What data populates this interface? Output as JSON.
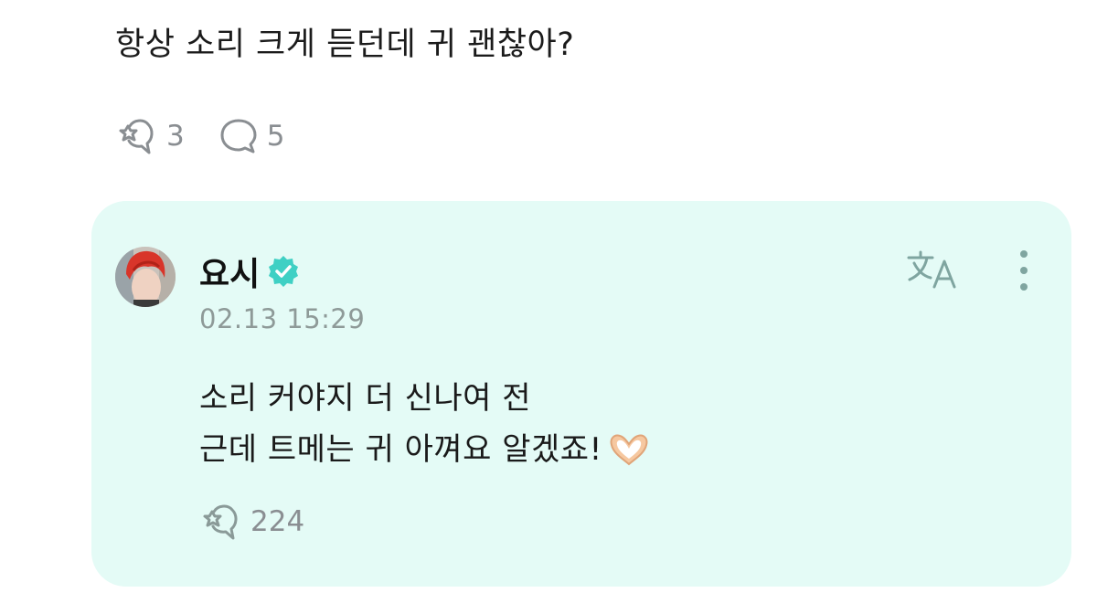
{
  "post": {
    "text": "항상 소리 크게 듣던데 귀 괜찮아?",
    "reaction_icon": "reaction-icon",
    "reaction_count": "3",
    "comment_icon": "comment-bubble-icon",
    "comment_count": "5"
  },
  "reply": {
    "author": "요시",
    "verified": true,
    "timestamp": "02.13 15:29",
    "lines": [
      "소리 커야지 더 신나여 전",
      "근데 트메는 귀 아껴요 알겠죠!"
    ],
    "emoji": "heart-hands",
    "reaction_count": "224",
    "translate_icon": "translate-icon",
    "more_icon": "more-vertical-icon"
  },
  "colors": {
    "card_background": "#e4fbf6",
    "accent": "#3fd0c4",
    "muted_text": "#8a8e92",
    "timestamp_text": "#8e9a98",
    "card_icon": "#7fa5a0"
  }
}
